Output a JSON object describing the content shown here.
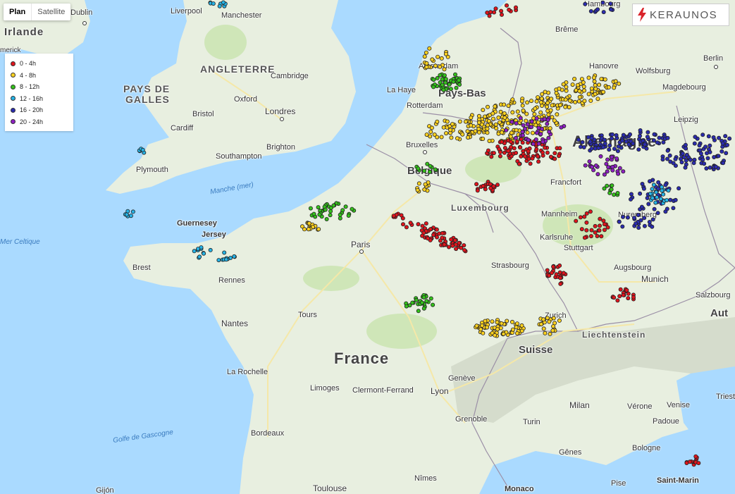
{
  "map_type": {
    "plan_label": "Plan",
    "satellite_label": "Satellite",
    "selected": "Plan"
  },
  "logo": {
    "text": "KERAUNOS",
    "icon": "lightning-bolt-icon",
    "accent_color": "#d9232a"
  },
  "legend": {
    "items": [
      {
        "label": "0 - 4h",
        "color": "#e0141c"
      },
      {
        "label": "4 - 8h",
        "color": "#ffd21f"
      },
      {
        "label": "8 - 12h",
        "color": "#34c21b"
      },
      {
        "label": "12 - 16h",
        "color": "#26b3e6"
      },
      {
        "label": "16 - 20h",
        "color": "#2b2cb0"
      },
      {
        "label": "20 - 24h",
        "color": "#8e1fc2"
      }
    ]
  },
  "labels": {
    "countries": [
      "Irlande",
      "ANGLETERRE",
      "PAYS DE",
      "GALLES",
      "Pays-Bas",
      "Belgique",
      "Luxembourg",
      "Allemagne",
      "France",
      "Suisse",
      "Liechtenstein",
      "Aut"
    ],
    "seas": [
      "Manche (mer)",
      "Mer Celtique",
      "Golfe de Gascogne"
    ],
    "cities": [
      "Dublin",
      "Liverpool",
      "Manchester",
      "Cambridge",
      "Oxford",
      "Londres",
      "Bristol",
      "Cardiff",
      "Southampton",
      "Brighton",
      "Plymouth",
      "Guernesey",
      "Jersey",
      "Brest",
      "Rennes",
      "Nantes",
      "Tours",
      "La Rochelle",
      "Limoges",
      "Clermont-Ferrand",
      "Lyon",
      "Genève",
      "Grenoble",
      "Bordeaux",
      "Toulouse",
      "Nîmes",
      "Monaco",
      "Gijón",
      "Paris",
      "Amsterdam",
      "La Haye",
      "Rotterdam",
      "Bruxelles",
      "Hambourg",
      "Brême",
      "Hanovre",
      "Wolfsburg",
      "Berlin",
      "Magdebourg",
      "Leipzig",
      "Francfort",
      "Mannheim",
      "Karlsruhe",
      "Stuttgart",
      "Strasbourg",
      "Nuremberg",
      "Augsbourg",
      "Munich",
      "Salzbourg",
      "Zurich",
      "Milan",
      "Turin",
      "Vérone",
      "Venise",
      "Padoue",
      "Trieste",
      "Bologne",
      "Gênes",
      "Pise",
      "Saint-Marin",
      "merick"
    ]
  },
  "chart_data": {
    "type": "scatter",
    "title": "",
    "legend_placement": "top-left",
    "clusters": [
      {
        "series": "0 - 4h",
        "color": "#e0141c",
        "region": "north-east France (Paris to Reims)"
      },
      {
        "series": "0 - 4h",
        "color": "#e0141c",
        "region": "central Germany"
      },
      {
        "series": "4 - 8h",
        "color": "#ffd21f",
        "region": "Netherlands / northern Germany"
      },
      {
        "series": "4 - 8h",
        "color": "#ffd21f",
        "region": "Jura / Switzerland"
      },
      {
        "series": "8 - 12h",
        "color": "#34c21b",
        "region": "Netherlands coast, Normandy, Burgundy"
      },
      {
        "series": "12 - 16h",
        "color": "#26b3e6",
        "region": "Brittany / Wales / east Germany"
      },
      {
        "series": "16 - 20h",
        "color": "#2b2cb0",
        "region": "eastern Germany"
      },
      {
        "series": "20 - 24h",
        "color": "#8e1fc2",
        "region": "western Germany"
      }
    ]
  }
}
